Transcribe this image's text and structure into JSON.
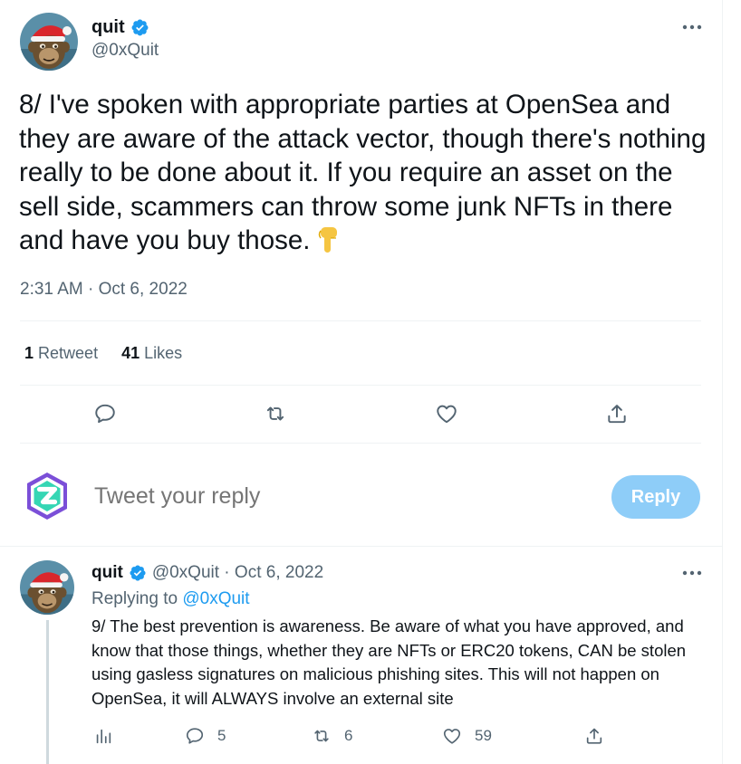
{
  "main_tweet": {
    "display_name": "quit",
    "handle": "@0xQuit",
    "text": "8/ I've spoken with appropriate parties at OpenSea and they are aware of the attack vector, though there's nothing really to be done about it. If you require an asset on the sell side, scammers can throw some junk NFTs in there and have you buy those.",
    "emoji": "backhand-index-pointing-down",
    "timestamp": "2:31 AM · Oct 6, 2022",
    "stats": {
      "retweets_count": "1",
      "retweets_label": "Retweet",
      "likes_count": "41",
      "likes_label": "Likes"
    },
    "actions": [
      "reply-icon",
      "retweet-icon",
      "like-icon",
      "share-icon"
    ]
  },
  "reply_box": {
    "placeholder": "Tweet your reply",
    "button_label": "Reply"
  },
  "reply_tweet": {
    "display_name": "quit",
    "handle_date": "@0xQuit · Oct 6, 2022",
    "replying_prefix": "Replying to",
    "replying_to": "@0xQuit",
    "text": "9/ The best prevention is awareness. Be aware of what you have approved, and know that those things, whether they are NFTs or ERC20 tokens, CAN be stolen using gasless signatures on malicious phishing sites. This will not happen on OpenSea, it will ALWAYS involve an external site",
    "reply_count": "5",
    "retweet_count": "6",
    "like_count": "59"
  },
  "colors": {
    "text_primary": "#0f1419",
    "text_secondary": "#536471",
    "accent": "#1d9bf0",
    "reply_button_disabled": "#8ecdf8",
    "divider": "#eff3f4"
  }
}
